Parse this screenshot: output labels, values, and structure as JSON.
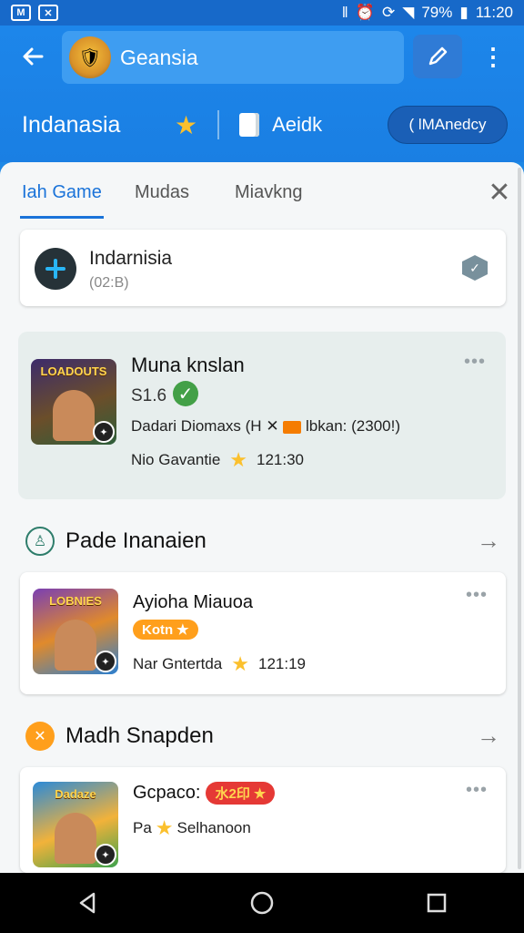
{
  "status_bar": {
    "left_icons": [
      "M",
      "app-icon"
    ],
    "battery": "79%",
    "time": "11:20"
  },
  "app_bar": {
    "search_title": "Geansia",
    "region": "Indanasia",
    "sub_label": "Aeidk",
    "pill_label": "( lMAnedcy"
  },
  "tabs": [
    {
      "label": "Iah Game",
      "active": true
    },
    {
      "label": "Mudas",
      "active": false
    },
    {
      "label": "Miavkng",
      "active": false
    }
  ],
  "group_card": {
    "title": "Indarnisia",
    "subtitle": "(02:B)"
  },
  "featured": {
    "title": "Muna knslan",
    "price": "S1.6",
    "description": "Dadari Diomaxs (H",
    "description_tail": "lbkan: (2300!)",
    "meta_label": "Nio Gavantie",
    "meta_value": "121:30",
    "thumb_title": "LOADOUTS"
  },
  "section1": {
    "title": "Pade Inanaien"
  },
  "app1": {
    "title": "Ayioha Miauoa",
    "tag": "Kotn",
    "meta_label": "Nar Gntertda",
    "meta_value": "121:19",
    "thumb_title": "LOBNIES"
  },
  "section2": {
    "title": "Madh Snapden"
  },
  "app2": {
    "title": "Gcpaco:",
    "tag": "水2印",
    "line2_prefix": "Pa",
    "line2_label": "Selhanoon",
    "thumb_title": "Dadaze"
  },
  "colors": {
    "primary": "#1e88e5",
    "accent_blue": "#1a73d9",
    "star": "#fbc02d",
    "check_green": "#43a047",
    "tag_orange": "#ff9f1c",
    "tag_red": "#e53935"
  }
}
